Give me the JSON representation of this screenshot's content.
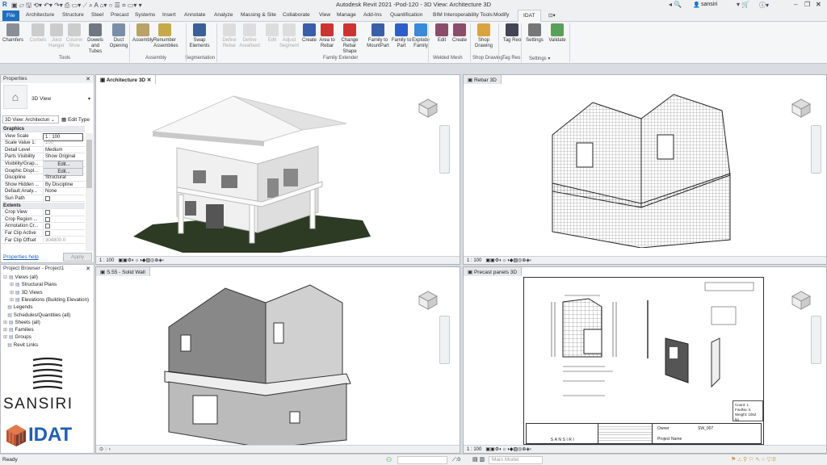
{
  "app": {
    "title": "Autodesk Revit 2021 -Pod-120 - 3D View: Architecture 3D",
    "user": "sansiri"
  },
  "tabs": [
    "File",
    "Architecture",
    "Structure",
    "Steel",
    "Precast",
    "Systems",
    "Insert",
    "Annotate",
    "Analyze",
    "Massing & Site",
    "Collaborate",
    "View",
    "Manage",
    "Add-Ins",
    "Quantification",
    "BIM Interoperability Tools",
    "Modify",
    "IDAT"
  ],
  "ribbon": {
    "buttons": [
      {
        "l": "Chamfers",
        "d": false,
        "c": "#8a8f96"
      },
      {
        "l": "Corbels",
        "d": true,
        "c": "#ccc"
      },
      {
        "l": "Joist Hanger",
        "d": true,
        "c": "#ccc"
      },
      {
        "l": "Column Shoe",
        "d": true,
        "c": "#ccc"
      },
      {
        "l": "Dowels and Tubes",
        "d": false,
        "c": "#707780"
      },
      {
        "l": "Duct Opening",
        "d": false,
        "c": "#7a8ea8"
      },
      {
        "l": "Assembly",
        "d": false,
        "c": "#b9a36a"
      },
      {
        "l": "Renumber Assemblies",
        "d": false,
        "c": "#c7a94a"
      },
      {
        "l": "Swap Elements",
        "d": false,
        "c": "#3c5f96"
      },
      {
        "l": "Define Rebar",
        "d": true,
        "c": "#ddd"
      },
      {
        "l": "Define Areafixed",
        "d": true,
        "c": "#ddd"
      },
      {
        "l": "Edit",
        "d": true,
        "c": "#ddd"
      },
      {
        "l": "Adjust Segment",
        "d": true,
        "c": "#ddd"
      },
      {
        "l": "Create",
        "d": false,
        "c": "#3a5ea8"
      },
      {
        "l": "Area to Rebar",
        "d": false,
        "c": "#c33"
      },
      {
        "l": "Change Rebar Shape",
        "d": false,
        "c": "#c33"
      },
      {
        "l": "Family to MountPart",
        "d": false,
        "c": "#3a5ea8"
      },
      {
        "l": "Family to Part",
        "d": false,
        "c": "#2d5fc9"
      },
      {
        "l": "Explode Family",
        "d": false,
        "c": "#3a8ad8"
      },
      {
        "l": "Edit",
        "d": false,
        "c": "#8a4d6a"
      },
      {
        "l": "Create",
        "d": false,
        "c": "#8a4d6a"
      },
      {
        "l": "Shop Drawing",
        "d": false,
        "c": "#d9a440"
      },
      {
        "l": "Tag Reo",
        "d": false,
        "c": "#445"
      },
      {
        "l": "Settings",
        "d": false,
        "c": "#777"
      },
      {
        "l": "Validate",
        "d": false,
        "c": "#5aa05a"
      }
    ],
    "panels": [
      "Tools",
      "Assembly",
      "Segmentation",
      "Family Extender",
      "Welded Mesh",
      "Shop Drawing",
      "Tag Reo",
      "Settings ▾"
    ]
  },
  "properties": {
    "title": "Properties",
    "type": "3D View",
    "selector": "3D View: Architectun",
    "edit_type": "Edit Type",
    "rows": [
      {
        "k": "Graphics",
        "g": true
      },
      {
        "k": "View Scale",
        "v": "1 : 100"
      },
      {
        "k": "Scale Value    1:",
        "v": "100"
      },
      {
        "k": "Detail Level",
        "v": "Medium"
      },
      {
        "k": "Parts Visibility",
        "v": "Show Original"
      },
      {
        "k": "Visibility/Grap...",
        "v": "Edit...",
        "b": true
      },
      {
        "k": "Graphic Displ...",
        "v": "Edit...",
        "b": true
      },
      {
        "k": "Discipline",
        "v": "Structural"
      },
      {
        "k": "Show Hidden ...",
        "v": "By Discipline"
      },
      {
        "k": "Default Analy...",
        "v": "None"
      },
      {
        "k": "Sun Path",
        "c": true
      },
      {
        "k": "Extents",
        "g": true
      },
      {
        "k": "Crop View",
        "c": true
      },
      {
        "k": "Crop Region ...",
        "c": true
      },
      {
        "k": "Annotation Cr...",
        "c": true
      },
      {
        "k": "Far Clip Active",
        "c": true
      },
      {
        "k": "Far Clip Offset",
        "v": "304800.0"
      }
    ],
    "help": "Properties help",
    "apply": "Apply"
  },
  "browser": {
    "title": "Project Browser - Project1",
    "items": [
      {
        "l": "Views (all)",
        "lv": 0,
        "e": "⊟"
      },
      {
        "l": "Structural Plans",
        "lv": 1,
        "e": "⊞"
      },
      {
        "l": "3D Views",
        "lv": 1,
        "e": "⊞"
      },
      {
        "l": "Elevations (Building Elevation)",
        "lv": 1,
        "e": "⊞"
      },
      {
        "l": "Legends",
        "lv": 0,
        "e": ""
      },
      {
        "l": "Schedules/Quantities (all)",
        "lv": 0,
        "e": ""
      },
      {
        "l": "Sheets (all)",
        "lv": 0,
        "e": "⊞"
      },
      {
        "l": "Families",
        "lv": 0,
        "e": "⊞"
      },
      {
        "l": "Groups",
        "lv": 0,
        "e": "⊞"
      },
      {
        "l": "Revit Links",
        "lv": 0,
        "e": ""
      }
    ]
  },
  "logos": {
    "sansiri": "SANSIRI",
    "idat": "IDAT"
  },
  "views": {
    "v1": "Architecture 3D",
    "v2": "Rebar 3D",
    "v3": "S.55 - Solid Wall",
    "v4": "Precast panels 3D",
    "scale": "1 : 100"
  },
  "sheet": {
    "count": "Count: 1",
    "fin": "FindNo: 5",
    "weight": "Weight: 1062 kg",
    "owner": "Owner",
    "project": "Project Name",
    "sheet_no": "SW_007",
    "logo": "SANSIRI"
  },
  "status": {
    "text": "Ready",
    "model": "Main Model",
    "zero1": ":0",
    "zero2": ":0"
  }
}
